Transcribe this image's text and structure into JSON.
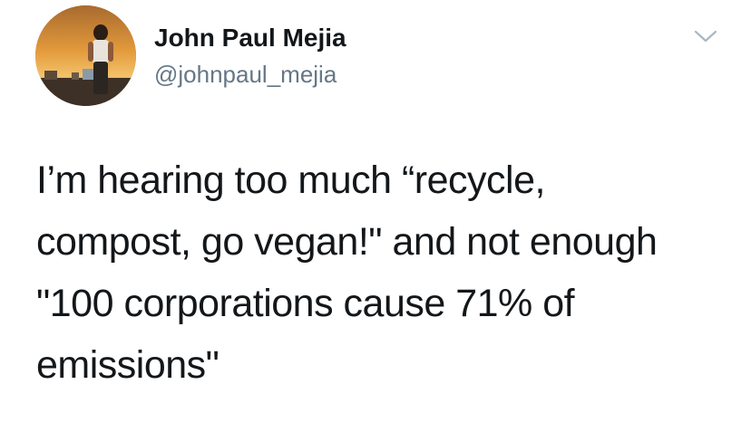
{
  "tweet": {
    "author": {
      "name": "John Paul Mejia",
      "handle": "@johnpaul_mejia",
      "avatar_icon": "avatar-photo"
    },
    "menu_icon": "chevron-down-icon",
    "text_lines": [
      "I’m hearing too much “recycle,",
      "compost, go vegan!\" and not enough",
      "\"100 corporations cause 71% of",
      "emissions\""
    ]
  },
  "colors": {
    "name": "#14171a",
    "handle": "#657786",
    "chevron": "#aab8c2",
    "background": "#ffffff"
  }
}
